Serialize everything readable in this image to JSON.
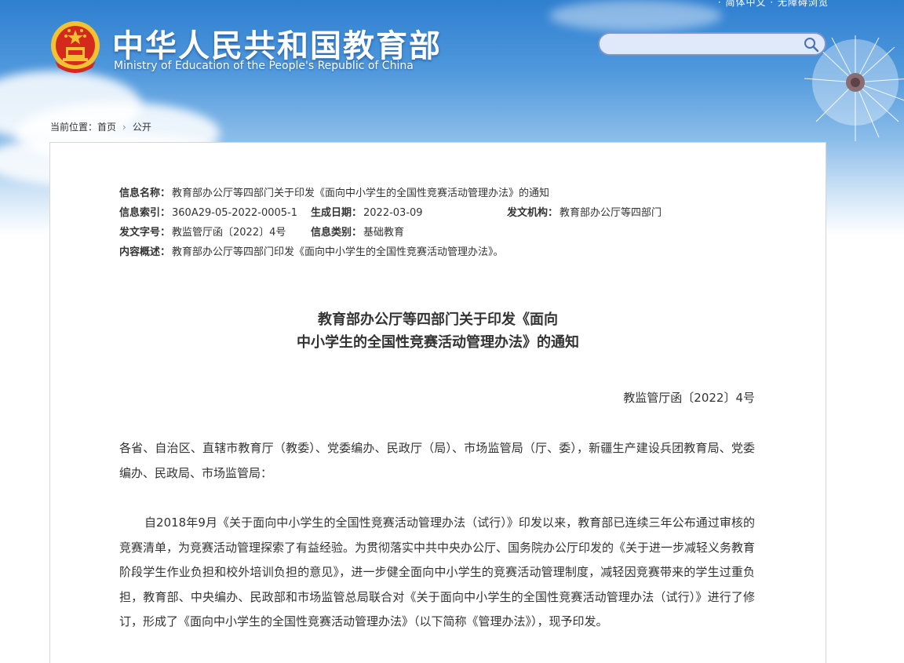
{
  "header": {
    "title_cn": "中华人民共和国教育部",
    "title_en": "Ministry of Education of the People's Republic of China",
    "top_links": "· 简体中文 · 无障碍浏览"
  },
  "search": {
    "placeholder": "",
    "icon": "search-icon"
  },
  "breadcrumb": {
    "label": "当前位置：",
    "items": [
      "首页",
      "公开"
    ],
    "separator": "›"
  },
  "meta": {
    "name_label": "信息名称：",
    "name_value": "教育部办公厅等四部门关于印发《面向中小学生的全国性竞赛活动管理办法》的通知",
    "index_label": "信息索引：",
    "index_value": "360A29-05-2022-0005-1",
    "date_label": "生成日期：",
    "date_value": "2022-03-09",
    "issuer_label": "发文机构：",
    "issuer_value": "教育部办公厅等四部门",
    "docno_label": "发文字号：",
    "docno_value": "教监管厅函〔2022〕4号",
    "category_label": "信息类别：",
    "category_value": "基础教育",
    "summary_label": "内容概述：",
    "summary_value": "教育部办公厅等四部门印发《面向中小学生的全国性竞赛活动管理办法》。"
  },
  "document": {
    "title_line1": "教育部办公厅等四部门关于印发《面向",
    "title_line2": "中小学生的全国性竞赛活动管理办法》的通知",
    "doc_number": "教监管厅函〔2022〕4号",
    "addressee": "各省、自治区、直辖市教育厅（教委）、党委编办、民政厅（局）、市场监管局（厅、委），新疆生产建设兵团教育局、党委编办、民政局、市场监管局：",
    "paragraph1": "自2018年9月《关于面向中小学生的全国性竞赛活动管理办法（试行）》印发以来，教育部已连续三年公布通过审核的竞赛清单，为竞赛活动管理探索了有益经验。为贯彻落实中共中央办公厅、国务院办公厅印发的《关于进一步减轻义务教育阶段学生作业负担和校外培训负担的意见》，进一步健全面向中小学生的竞赛活动管理制度，减轻因竞赛带来的学生过重负担，教育部、中央编办、民政部和市场监管总局联合对《关于面向中小学生的全国性竞赛活动管理办法（试行）》进行了修订，形成了《面向中小学生的全国性竞赛活动管理办法》（以下简称《管理办法》），现予印发。"
  },
  "colors": {
    "sky_top": "#2f7fd0",
    "emblem_red": "#d42a1e",
    "emblem_gold": "#f2c230",
    "search_border": "#7f95c9",
    "text": "#333333"
  }
}
